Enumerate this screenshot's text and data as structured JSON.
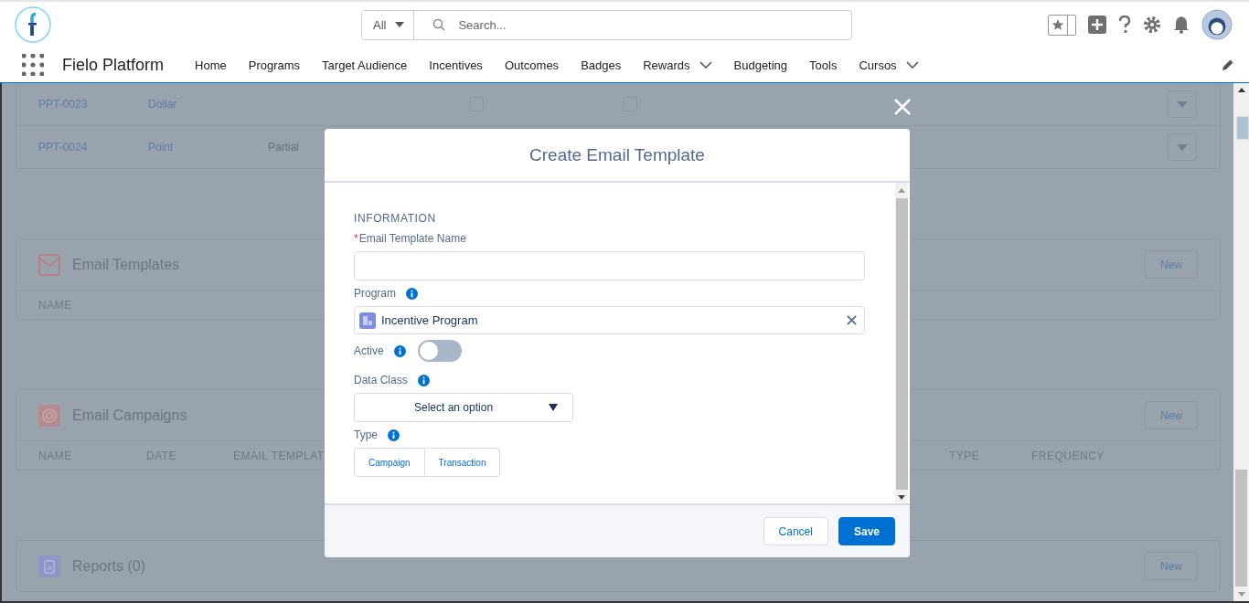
{
  "header": {
    "search_scope": "All",
    "search_placeholder": "Search...",
    "app_name": "Fielo Platform",
    "nav": [
      {
        "label": "Home",
        "dropdown": false
      },
      {
        "label": "Programs",
        "dropdown": false
      },
      {
        "label": "Target Audience",
        "dropdown": false
      },
      {
        "label": "Incentives",
        "dropdown": false
      },
      {
        "label": "Outcomes",
        "dropdown": false
      },
      {
        "label": "Badges",
        "dropdown": false
      },
      {
        "label": "Rewards",
        "dropdown": true
      },
      {
        "label": "Budgeting",
        "dropdown": false
      },
      {
        "label": "Tools",
        "dropdown": false
      },
      {
        "label": "Cursos",
        "dropdown": true
      }
    ]
  },
  "records": [
    {
      "id": "PPT-0023",
      "type": "Dollar",
      "checks": [
        {
          "checked": false
        },
        {
          "checked": false
        }
      ]
    },
    {
      "id": "PPT-0024",
      "type": "Point",
      "column_3": "Partial"
    }
  ],
  "sections": [
    {
      "kind": "envelope",
      "title": "Email Templates",
      "button": "New",
      "columns": [
        "NAME"
      ]
    },
    {
      "kind": "target",
      "title": "Email Campaigns",
      "button": "New",
      "columns": [
        "NAME",
        "DATE",
        "EMAIL TEMPLAT",
        "TYPE",
        "FREQUENCY"
      ]
    },
    {
      "kind": "report",
      "title": "Reports (0)",
      "button": "New"
    }
  ],
  "modal": {
    "title": "Create Email Template",
    "section": "INFORMATION",
    "fields": [
      {
        "kind": "text",
        "label": "Email Template Name",
        "required_mark": "*",
        "info": false
      },
      {
        "kind": "lookup",
        "label": "Program",
        "info": true,
        "value": "Incentive Program"
      },
      {
        "kind": "toggle",
        "label": "Active",
        "info": true,
        "on": false
      },
      {
        "kind": "select",
        "label": "Data Class",
        "info": true,
        "placeholder": "Select an option"
      },
      {
        "kind": "buttons",
        "label": "Type",
        "info": true,
        "options": [
          {
            "label": "Campaign",
            "selected": false
          },
          {
            "label": "Transaction",
            "selected": false
          }
        ]
      }
    ],
    "buttons": [
      {
        "kind": "neutral",
        "label": "Cancel"
      },
      {
        "kind": "brand",
        "label": "Save"
      }
    ]
  }
}
